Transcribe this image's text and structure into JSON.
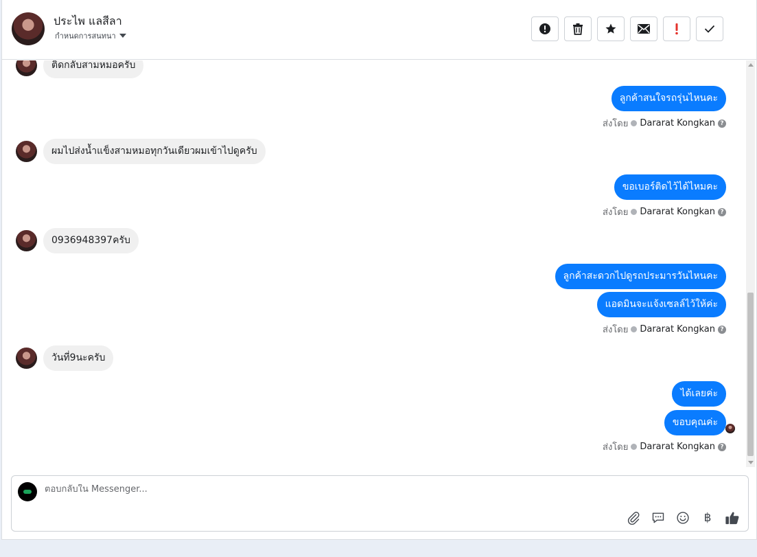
{
  "header": {
    "contact_name": "ประไพ แลสีลา",
    "assign_label": "กำหนดการสนทนา"
  },
  "toolbar": {
    "spam_title": "spam",
    "delete_title": "delete",
    "star_title": "star",
    "unread_title": "mark unread",
    "follow_up_title": "follow up",
    "done_title": "done"
  },
  "messages": {
    "in_1": "ติดกลับสามหมอครับ",
    "out_1": "ลูกค้าสนใจรถรุ่นไหนคะ",
    "in_2": "ผมไปส่งน้ำแข็งสามหมอทุกวันเดียวผมเข้าไปดูครับ",
    "out_2": "ขอเบอร์ติดไว้ได้ไหมคะ",
    "in_3": "0936948397ครับ",
    "out_3a": "ลูกค้าสะดวกไปดูรถประมารวันไหนคะ",
    "out_3b": "แอดมินจะแจ้งเซลล์ไว้ให้ค่ะ",
    "in_4": "วันที่9นะครับ",
    "out_4a": "ได้เลยค่ะ",
    "out_4b": "ขอบคุณค่ะ"
  },
  "sent_by": {
    "prefix": "ส่งโดย",
    "agent": "Dararat Kongkan",
    "help": "?"
  },
  "composer": {
    "placeholder": "ตอบกลับใน Messenger...",
    "baht_symbol": "฿"
  },
  "colors": {
    "outgoing_bubble": "#0a7cff",
    "incoming_bubble": "#f0f0f0"
  }
}
